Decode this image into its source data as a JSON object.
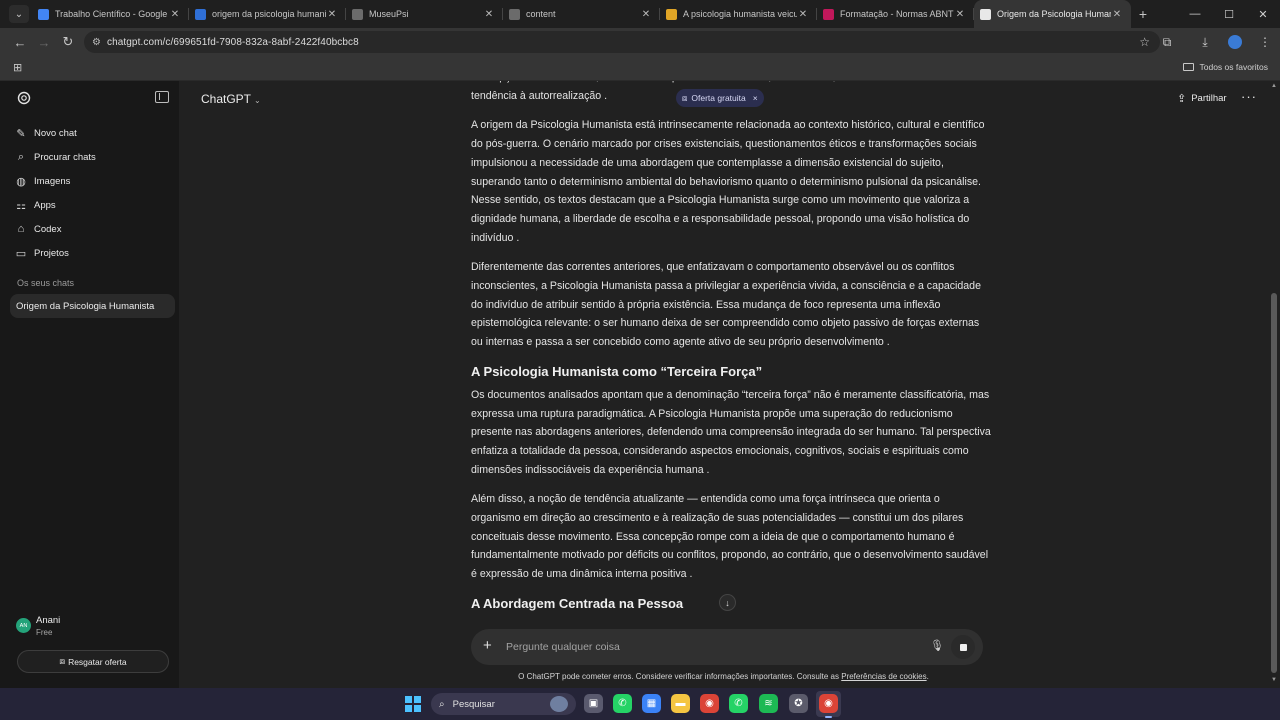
{
  "browser": {
    "tabs": [
      {
        "title": "Trabalho Científico - Google Do",
        "favicon_color": "#4285f4",
        "icon": "docs-icon",
        "active": false
      },
      {
        "title": "origem da psicologia humanista",
        "favicon_color": "#2f6fd6",
        "icon": "bird-icon",
        "active": false
      },
      {
        "title": "MuseuPsi",
        "favicon_color": "#6b6b6b",
        "icon": "globe-icon",
        "active": false
      },
      {
        "title": "content",
        "favicon_color": "#6b6b6b",
        "icon": "globe-icon",
        "active": false
      },
      {
        "title": "A psicologia humanista veicula",
        "favicon_color": "#e0a526",
        "icon": "document-icon",
        "active": false
      },
      {
        "title": "Formatação - Normas ABNT",
        "favicon_color": "#c2185b",
        "icon": "abnt-icon",
        "active": false
      },
      {
        "title": "Origem da Psicologia Humanis",
        "favicon_color": "#e8e8e8",
        "icon": "chatgpt-icon",
        "active": true
      }
    ],
    "url": "chatgpt.com/c/699651fd-7908-832a-8abf-2422f40bcbc8",
    "bookmarks_all": "Todos os favoritos"
  },
  "sidebar": {
    "items": [
      {
        "label": "Novo chat",
        "icon": "new-chat-icon",
        "glyph": "✎"
      },
      {
        "label": "Procurar chats",
        "icon": "search-icon",
        "glyph": "⌕"
      },
      {
        "label": "Imagens",
        "icon": "images-icon",
        "glyph": "◍"
      },
      {
        "label": "Apps",
        "icon": "apps-icon",
        "glyph": "⚏"
      },
      {
        "label": "Codex",
        "icon": "codex-icon",
        "glyph": "⌂"
      },
      {
        "label": "Projetos",
        "icon": "folder-icon",
        "glyph": "▭"
      }
    ],
    "section_label": "Os seus chats",
    "chats": [
      {
        "title": "Origem da Psicologia Humanista"
      }
    ],
    "user": {
      "initials": "AN",
      "name": "Anani",
      "plan": "Free"
    },
    "offer_button": "Resgatar oferta"
  },
  "header": {
    "model": "ChatGPT",
    "share_label": "Partilhar",
    "promo_pill": "Oferta gratuita"
  },
  "article": {
    "blocks": [
      {
        "type": "p",
        "text": "concepção de ser humano, centrada na experiência consciente, na liberdade, na intencionalidade e na tendência à autorrealização ."
      },
      {
        "type": "p",
        "text": "A origem da Psicologia Humanista está intrinsecamente relacionada ao contexto histórico, cultural e científico do pós-guerra. O cenário marcado por crises existenciais, questionamentos éticos e transformações sociais impulsionou a necessidade de uma abordagem que contemplasse a dimensão existencial do sujeito, superando tanto o determinismo ambiental do behaviorismo quanto o determinismo pulsional da psicanálise. Nesse sentido, os textos destacam que a Psicologia Humanista surge como um movimento que valoriza a dignidade humana, a liberdade de escolha e a responsabilidade pessoal, propondo uma visão holística do indivíduo ."
      },
      {
        "type": "p",
        "text": "Diferentemente das correntes anteriores, que enfatizavam o comportamento observável ou os conflitos inconscientes, a Psicologia Humanista passa a privilegiar a experiência vivida, a consciência e a capacidade do indivíduo de atribuir sentido à própria existência. Essa mudança de foco representa uma inflexão epistemológica relevante: o ser humano deixa de ser compreendido como objeto passivo de forças externas ou internas e passa a ser concebido como agente ativo de seu próprio desenvolvimento ."
      },
      {
        "type": "h",
        "text": "A Psicologia Humanista como “Terceira Força”"
      },
      {
        "type": "p",
        "text": "Os documentos analisados apontam que a denominação “terceira força” não é meramente classificatória, mas expressa uma ruptura paradigmática. A Psicologia Humanista propõe uma superação do reducionismo presente nas abordagens anteriores, defendendo uma compreensão integrada do ser humano. Tal perspectiva enfatiza a totalidade da pessoa, considerando aspectos emocionais, cognitivos, sociais e espirituais como dimensões indissociáveis da experiência humana ."
      },
      {
        "type": "p",
        "text": "Além disso, a noção de tendência atualizante — entendida como uma força intrínseca que orienta o organismo em direção ao crescimento e à realização de suas potencialidades — constitui um dos pilares conceituais desse movimento. Essa concepção rompe com a ideia de que o comportamento humano é fundamentalmente motivado por déficits ou conflitos, propondo, ao contrário, que o desenvolvimento saudável é expressão de uma dinâmica interna positiva ."
      },
      {
        "type": "h",
        "text": "A Abordagem Centrada na Pessoa"
      }
    ]
  },
  "composer": {
    "placeholder": "Pergunte qualquer coisa"
  },
  "disclaimer": {
    "text": "O ChatGPT pode cometer erros. Considere verificar informações importantes. Consulte as ",
    "link": "Preferências de cookies",
    "suffix": "."
  },
  "taskbar": {
    "search_label": "Pesquisar",
    "apps": [
      {
        "name": "taskview-icon",
        "color": "#5a5a6e",
        "glyph": "▣"
      },
      {
        "name": "whatsapp-icon",
        "color": "#25d366",
        "glyph": "✆"
      },
      {
        "name": "store-icon",
        "color": "#3b82f6",
        "glyph": "▦"
      },
      {
        "name": "file-explorer-icon",
        "color": "#f5c542",
        "glyph": "▬"
      },
      {
        "name": "chrome-icon",
        "color": "#db4437",
        "glyph": "◉"
      },
      {
        "name": "whatsapp-business-icon",
        "color": "#25d366",
        "glyph": "✆"
      },
      {
        "name": "spotify-icon",
        "color": "#1db954",
        "glyph": "≋"
      },
      {
        "name": "github-desktop-icon",
        "color": "#5b5b6b",
        "glyph": "✪"
      },
      {
        "name": "chrome-active-icon",
        "color": "#db4437",
        "glyph": "◉"
      }
    ]
  }
}
